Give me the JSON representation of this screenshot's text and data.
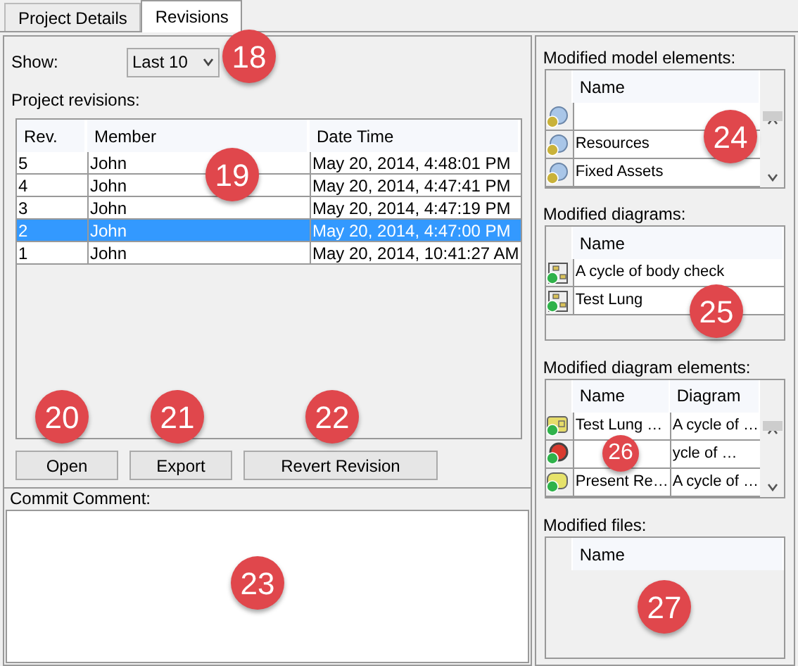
{
  "tabs": [
    {
      "label": "Project Details",
      "selected": false
    },
    {
      "label": "Revisions",
      "selected": true
    }
  ],
  "show": {
    "label": "Show:",
    "value": "Last 10"
  },
  "revisions": {
    "label": "Project revisions:",
    "columns": [
      "Rev.",
      "Member",
      "Date Time"
    ],
    "rows": [
      {
        "cells": [
          "5",
          "John",
          "May 20, 2014, 4:48:01 PM"
        ],
        "selected": false
      },
      {
        "cells": [
          "4",
          "John",
          "May 20, 2014, 4:47:41 PM"
        ],
        "selected": false
      },
      {
        "cells": [
          "3",
          "John",
          "May 20, 2014, 4:47:19 PM"
        ],
        "selected": false
      },
      {
        "cells": [
          "2",
          "John",
          "May 20, 2014, 4:47:00 PM"
        ],
        "selected": true
      },
      {
        "cells": [
          "1",
          "John",
          "May 20, 2014, 10:41:27 AM"
        ],
        "selected": false
      }
    ]
  },
  "buttons": [
    "Open",
    "Export",
    "Revert Revision"
  ],
  "commit_comment": {
    "label": "Commit Comment:"
  },
  "model_elements": {
    "label": "Modified model elements:",
    "columns": [
      "Name"
    ],
    "rows": [
      {
        "kind": "model",
        "cells": [
          ""
        ]
      },
      {
        "kind": "model",
        "cells": [
          "Resources"
        ]
      },
      {
        "kind": "model",
        "cells": [
          "Fixed Assets"
        ]
      }
    ]
  },
  "diagrams": {
    "label": "Modified diagrams:",
    "columns": [
      "Name"
    ],
    "rows": [
      {
        "kind": "diagram",
        "cells": [
          "A cycle of body check"
        ]
      },
      {
        "kind": "diagram",
        "cells": [
          "Test Lung"
        ]
      }
    ]
  },
  "diagram_elements": {
    "label": "Modified diagram elements:",
    "columns": [
      "Name",
      "Diagram"
    ],
    "rows": [
      {
        "kind": "frame",
        "cells": [
          "Test Lung …",
          "A cycle of …"
        ]
      },
      {
        "kind": "event",
        "cells": [
          "",
          "ycle of …"
        ]
      },
      {
        "kind": "activity",
        "cells": [
          "Present Re…",
          "A cycle of …"
        ]
      }
    ]
  },
  "files": {
    "label": "Modified files:",
    "columns": [
      "Name"
    ]
  },
  "callouts": [
    "18",
    "19",
    "20",
    "21",
    "22",
    "23",
    "24",
    "25",
    "26",
    "27"
  ]
}
